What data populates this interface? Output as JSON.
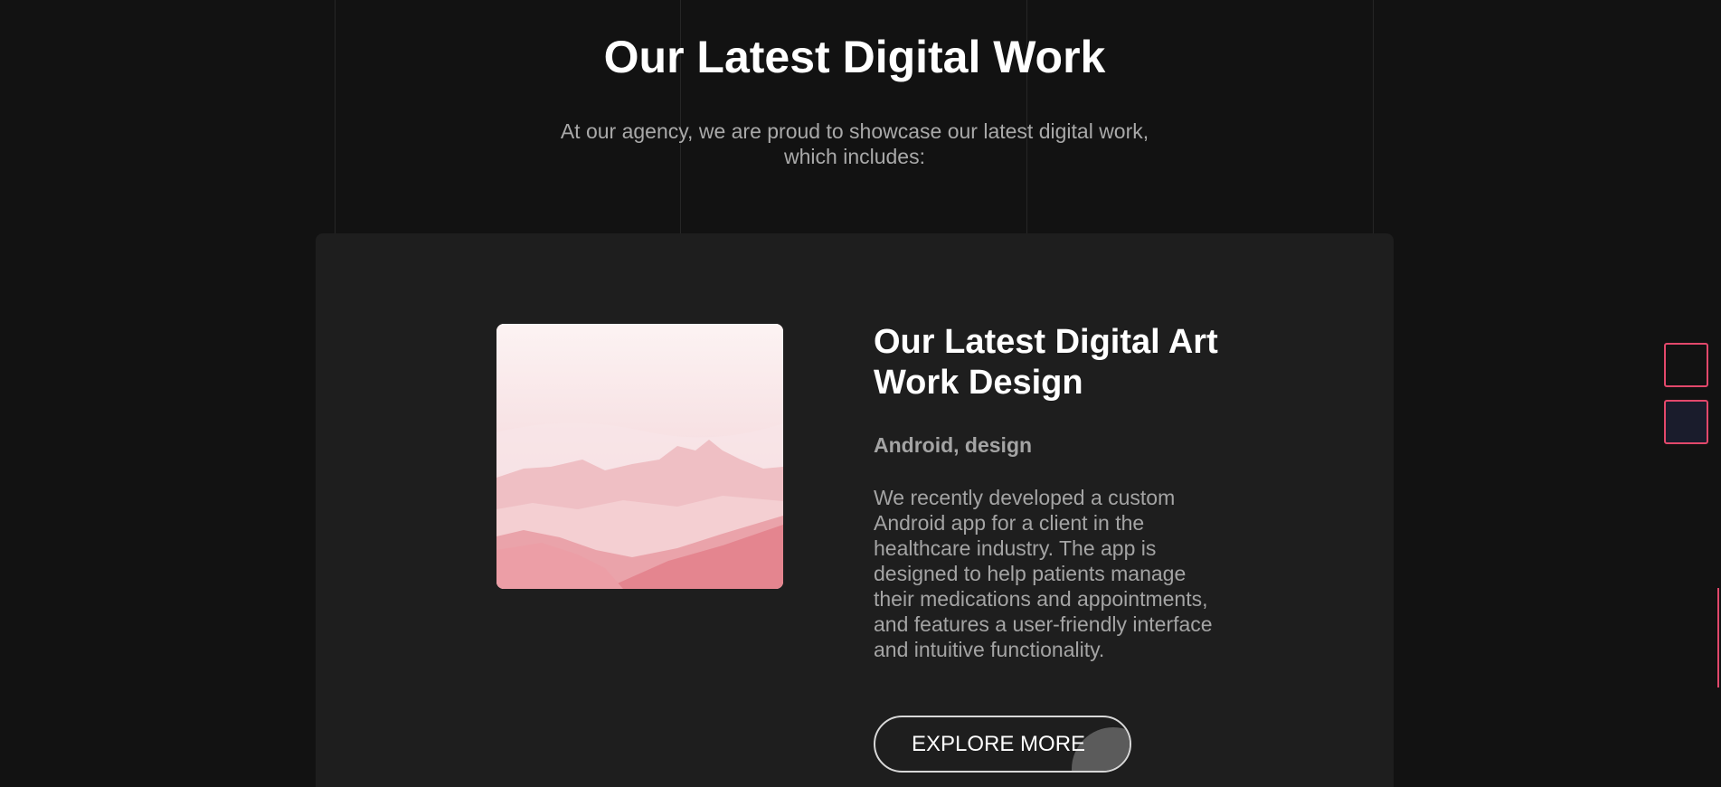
{
  "section": {
    "title": "Our Latest Digital Work",
    "subtitle": "At our agency, we are proud to showcase our latest digital work, which includes:"
  },
  "work": {
    "image_description": "pink mountain landscape",
    "title": "Our Latest Digital Art Work Design",
    "tags": "Android, design",
    "description": "We recently developed a custom Android app for a client in the healthcare industry. The app is designed to help patients manage their medications and appointments, and features a user-friendly interface and intuitive functionality.",
    "button_label": "EXPLORE MORE"
  },
  "side_controls": {
    "buttons": [
      "side-button-1",
      "side-button-2"
    ]
  },
  "colors": {
    "page_background": "#121212",
    "card_background": "#1e1e1e",
    "heading_text": "#ffffff",
    "body_text": "#a4a4a4",
    "accent": "#e2486b"
  }
}
